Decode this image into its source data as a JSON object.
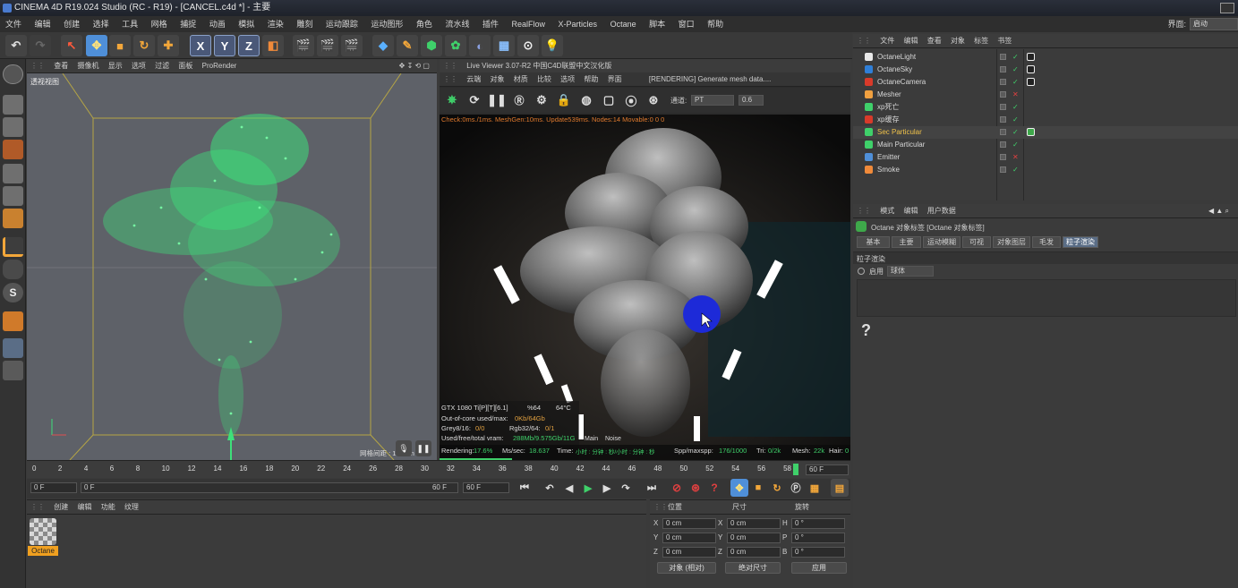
{
  "window": {
    "title": "CINEMA 4D R19.024 Studio (RC - R19) - [CANCEL.c4d *] - 主要"
  },
  "menu": {
    "items": [
      "文件",
      "编辑",
      "创建",
      "选择",
      "工具",
      "网格",
      "捕捉",
      "动画",
      "模拟",
      "渲染",
      "雕刻",
      "运动跟踪",
      "运动图形",
      "角色",
      "流水线",
      "插件",
      "RealFlow",
      "X-Particles",
      "Octane",
      "脚本",
      "窗口",
      "帮助"
    ],
    "layout_label": "界面:",
    "layout_value": "启动"
  },
  "viewport": {
    "menu": [
      "查看",
      "摄像机",
      "显示",
      "选项",
      "过滤",
      "面板",
      "ProRender"
    ],
    "label": "透视视图",
    "grid_label": "网格间距 : 100 cm"
  },
  "live_viewer": {
    "title": "Live Viewer 3.07-R2 中国C4D联盟中文汉化版",
    "menu": [
      "云端",
      "对象",
      "材质",
      "比较",
      "选项",
      "帮助",
      "界面"
    ],
    "status": "[RENDERING] Generate mesh data....",
    "channel_label": "通道:",
    "channel_value": "PT",
    "value": "0.6",
    "check_line": "Check:0ms./1ms. MeshGen:10ms. Update539ms. Nodes:14 Movable:0  0 0",
    "gpu": "GTX 1080 Ti[P][T][6.1]",
    "gpu_pct": "%64",
    "gpu_temp": "64°C",
    "out_of_core_label": "Out-of-core used/max:",
    "out_of_core_value": "0Kb/64Gb",
    "grey": "Grey8/16:",
    "grey_value": "0/0",
    "rgb": "Rgb32/64:",
    "rgb_value": "0/1",
    "vram_label": "Used/free/total vram:",
    "vram_value": "288Mb/9.575Gb/11G",
    "tabs": [
      "Main",
      "Noise"
    ],
    "rendering_label": "Rendering:",
    "rendering_value": "17.6%",
    "ms_label": "Ms/sec:",
    "ms_value": "18.637",
    "time_label": "Time:",
    "time_value": "小时 : 分钟 : 秒/小时 : 分钟 : 秒",
    "spp_label": "Spp/maxspp:",
    "spp_value": "176/1000",
    "tri_label": "Tri:",
    "tri_value": "0/2k",
    "mesh_label": "Mesh:",
    "mesh_value": "22k",
    "hair_label": "Hair:",
    "hair_value": "0",
    "progress": 0.176
  },
  "object_manager": {
    "menu": [
      "文件",
      "编辑",
      "查看",
      "对象",
      "标签",
      "书签"
    ],
    "objects": [
      {
        "name": "OctaneLight",
        "color": "#d8d8d8",
        "icon": "light-icon"
      },
      {
        "name": "OctaneSky",
        "color": "#d8d8d8",
        "icon": "sky-icon"
      },
      {
        "name": "OctaneCamera",
        "color": "#d8d8d8",
        "icon": "camera-icon"
      },
      {
        "name": "Mesher",
        "color": "#d8d8d8",
        "icon": "mesher-icon"
      },
      {
        "name": "xp死亡",
        "color": "#d8d8d8",
        "icon": "kill-icon"
      },
      {
        "name": "xp缓存",
        "color": "#d8d8d8",
        "icon": "cache-icon"
      },
      {
        "name": "Sec Particular",
        "color": "#f0c24a",
        "icon": "emitter-icon"
      },
      {
        "name": "Main Particular",
        "color": "#d8d8d8",
        "icon": "emitter-icon"
      },
      {
        "name": "Emitter",
        "color": "#d8d8d8",
        "icon": "sphere-icon"
      },
      {
        "name": "Smoke",
        "color": "#d8d8d8",
        "icon": "smoke-icon"
      }
    ]
  },
  "attribute_manager": {
    "menu": [
      "模式",
      "编辑",
      "用户数据"
    ],
    "title": "Octane 对象标签 [Octane 对象标签]",
    "tabs": [
      "基本",
      "主要",
      "运动模糊",
      "可视",
      "对象图层",
      "毛发",
      "粒子渲染"
    ],
    "section": "粒子渲染",
    "enable_label": "启用",
    "enable_value": "球体",
    "help": "?"
  },
  "timeline": {
    "ticks": [
      "0",
      "2",
      "4",
      "6",
      "8",
      "10",
      "12",
      "14",
      "16",
      "18",
      "20",
      "22",
      "24",
      "26",
      "28",
      "30",
      "32",
      "34",
      "36",
      "38",
      "40",
      "42",
      "44",
      "46",
      "48",
      "50",
      "52",
      "54",
      "56",
      "58"
    ],
    "current_frame": "60 F",
    "start": "0 F",
    "range_start": "0 F",
    "range_end": "60 F",
    "end": "60 F"
  },
  "material_manager": {
    "menu": [
      "创建",
      "编辑",
      "功能",
      "纹理"
    ],
    "material": "Octane"
  },
  "coordinates": {
    "headers": [
      "位置",
      "尺寸",
      "旋转"
    ],
    "rows": [
      {
        "a": "X",
        "av": "0 cm",
        "b": "X",
        "bv": "0 cm",
        "c": "H",
        "cv": "0 °"
      },
      {
        "a": "Y",
        "av": "0 cm",
        "b": "Y",
        "bv": "0 cm",
        "c": "P",
        "cv": "0 °"
      },
      {
        "a": "Z",
        "av": "0 cm",
        "b": "Z",
        "bv": "0 cm",
        "c": "B",
        "cv": "0 °"
      }
    ],
    "mode": "对象 (相对)",
    "size_mode": "绝对尺寸",
    "apply": "应用"
  },
  "colors": {
    "accent_blue": "#4f8fd8",
    "particles": "#3ee07a",
    "highlight": "#f0c24a",
    "active_tab": "#5a6d86"
  }
}
